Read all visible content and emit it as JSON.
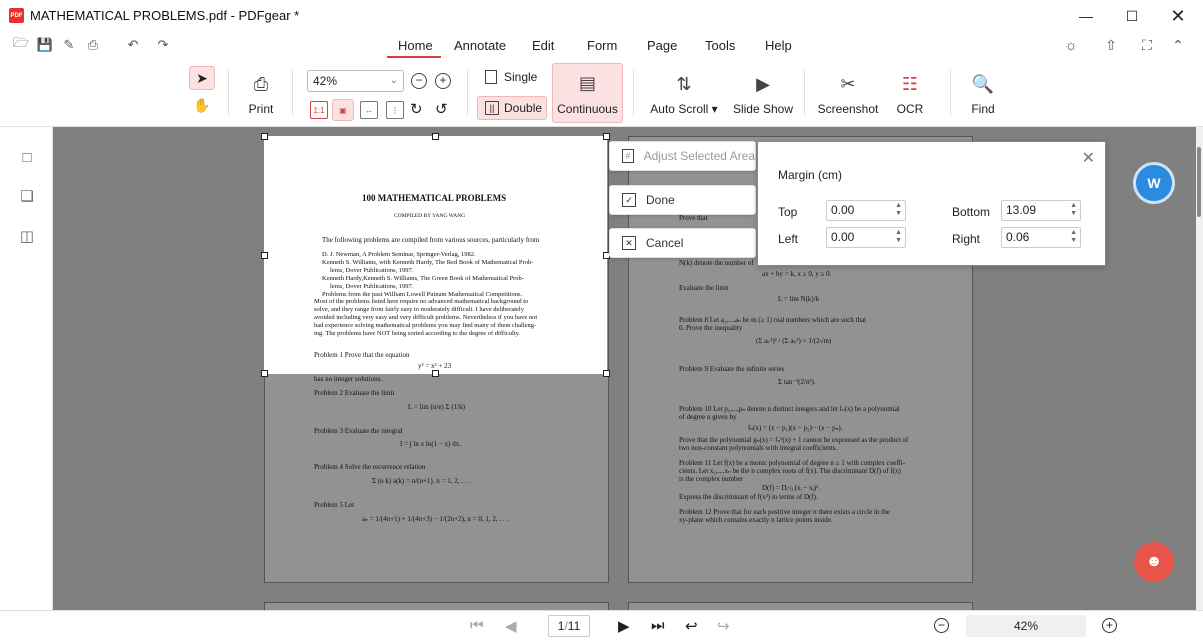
{
  "window": {
    "title": "MATHEMATICAL PROBLEMS.pdf - PDFgear *",
    "logo_text": "PDF"
  },
  "menu": {
    "tabs": [
      "Home",
      "Annotate",
      "Edit",
      "Form",
      "Page",
      "Tools",
      "Help"
    ],
    "active": "Home"
  },
  "ribbon": {
    "print": "Print",
    "zoom_value": "42%",
    "single": "Single",
    "double": "Double",
    "continuous": "Continuous",
    "auto_scroll": "Auto Scroll",
    "slide_show": "Slide Show",
    "screenshot": "Screenshot",
    "ocr": "OCR",
    "find": "Find",
    "fit_actual_label": "1:1"
  },
  "popup": {
    "adjust": "Adjust Selected Area",
    "done": "Done",
    "cancel": "Cancel"
  },
  "margin": {
    "title": "Margin (cm)",
    "top_label": "Top",
    "top_value": "0.00",
    "left_label": "Left",
    "left_value": "0.00",
    "bottom_label": "Bottom",
    "bottom_value": "13.09",
    "right_label": "Right",
    "right_value": "0.06"
  },
  "document": {
    "page1": {
      "title": "100 MATHEMATICAL PROBLEMS",
      "compiled": "COMPILED BY YANG WANG",
      "intro": "The following problems are compiled from various sources, particularly from",
      "bullets": [
        "D. J. Newman, A Problem Seminar, Springer-Verlag, 1982.",
        "Kenneth S. Williams, with Kenneth Hardy, The Red Book of Mathematical Prob-",
        "lems, Dover Publications, 1997.",
        "Kenneth Hardy,Kenneth S. Williams, The Green Book of Mathematical Prob-",
        "lems, Dover Publications, 1997.",
        "Problems from the past William Lowell Putnam Mathematical Competitions."
      ],
      "para": [
        "Most of the problems listed here require no advanced mathematical background to",
        "solve, and they range from fairly easy to moderately difficult. I have deliberately",
        "avoided including very easy and very difficult problems. Nevertheless if you have not",
        "had experience solving mathematical problems you may find many of them challeng-",
        "ing. The problems have NOT being sorted according to the degree of difficulty."
      ],
      "p1": "Problem 1   Prove that the equation",
      "p1_eq": "y² = x³ + 23",
      "p1_tail": "has no integer solutions.",
      "p2": "Problem 2   Evaluate the limit",
      "p3": "Problem 3   Evaluate the integral",
      "p4": "Problem 4   Solve the recurrence relation",
      "p5": "Problem 5   Let"
    },
    "page2": {
      "lines": [
        "Prove that",
        "N(k) denote the number of",
        "ax + by = k, x ≥ 0, y ≥ 0.",
        "Evaluate the limit",
        "Problem 8   Let a₁,...,aₙ be m (≥ 1) real numbers which are such that",
        "0. Prove the inequality",
        "Problem 9   Evaluate the infinite series",
        "Problem 10   Let p₁,...,pₙ denote n distinct integers and let fₙ(x) be a polynomial",
        "of degree n given by",
        "fₙ(x) = (x − p₁)(x − p₂)···(x − pₙ).",
        "Prove that the polynomial gₙ(x) = fₙ²(x) + 1 cannot be expressed as the product of",
        "two non-constant polynomials with integral coefficients.",
        "Problem 11   Let f(x) be a monic polynomial of degree n ≥ 1 with complex coeffi-",
        "cients. Let x₁,...,xₙ be the n complex roots of f(x). The discriminant D(f) of f(x)",
        "is the complex number",
        "Express the discriminant of f(x²) in terms of D(f).",
        "Problem 12   Prove that for each positive integer n there exists a circle in the",
        "xy-plane which contains exactly n lattice points inside."
      ]
    }
  },
  "status": {
    "page_current": "1",
    "page_total": "11",
    "zoom": "42%"
  },
  "floating": {
    "convert_label": "W"
  }
}
